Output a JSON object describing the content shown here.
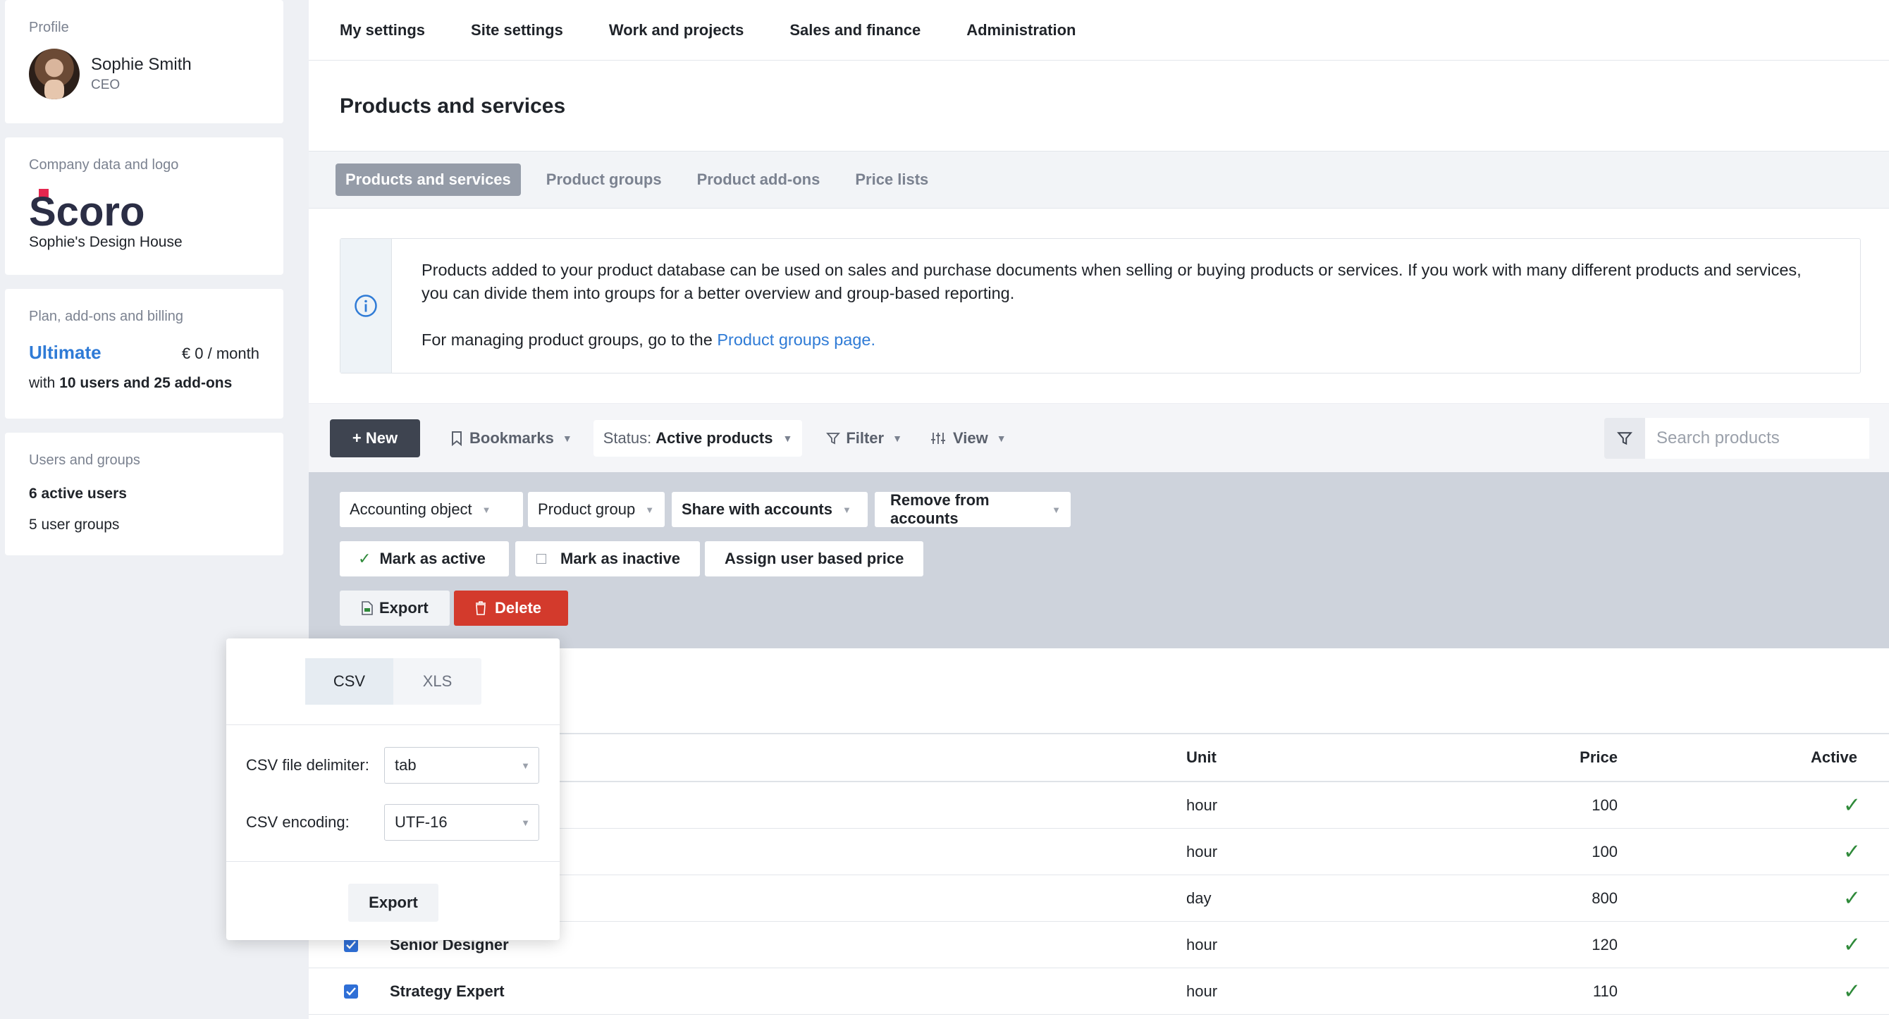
{
  "sidebar": {
    "profile": {
      "label": "Profile",
      "name": "Sophie Smith",
      "role": "CEO"
    },
    "company": {
      "label": "Company data and logo",
      "logo_text": "Scoro",
      "name": "Sophie's Design House"
    },
    "plan": {
      "label": "Plan, add-ons and billing",
      "name": "Ultimate",
      "price": "€ 0 / month",
      "detail_prefix": "with ",
      "detail_bold": "10 users and 25 add-ons"
    },
    "users": {
      "label": "Users and groups",
      "active": "6 active users",
      "groups": "5 user groups"
    }
  },
  "topnav": [
    "My settings",
    "Site settings",
    "Work and projects",
    "Sales and finance",
    "Administration"
  ],
  "page_title": "Products and services",
  "tabs": [
    {
      "label": "Products and services",
      "active": true
    },
    {
      "label": "Product groups",
      "active": false
    },
    {
      "label": "Product add-ons",
      "active": false
    },
    {
      "label": "Price lists",
      "active": false
    }
  ],
  "info": {
    "line1": "Products added to your product database can be used on sales and purchase documents when selling or buying products or services. If you work with many different products and services, you can divide them into groups for a better overview and group-based reporting.",
    "line2_prefix": "For managing product groups, go to the ",
    "link": "Product groups page."
  },
  "toolbar": {
    "new_label": "+ New",
    "bookmarks": "Bookmarks",
    "status_prefix": "Status:",
    "status_value": "Active products",
    "filter": "Filter",
    "view": "View",
    "search_placeholder": "Search products"
  },
  "bulk": {
    "accounting_object": "Accounting object",
    "product_group": "Product group",
    "share": "Share with accounts",
    "remove": "Remove from accounts",
    "mark_active": "Mark as active",
    "mark_inactive": "Mark as inactive",
    "assign_price": "Assign user based price",
    "export": "Export",
    "delete": "Delete"
  },
  "table": {
    "headers": {
      "unit": "Unit",
      "price": "Price",
      "active": "Active"
    },
    "rows": [
      {
        "name": "",
        "unit": "hour",
        "price": "100"
      },
      {
        "name": "",
        "unit": "hour",
        "price": "100"
      },
      {
        "name": "",
        "unit": "day",
        "price": "800"
      },
      {
        "name": "Senior Designer",
        "unit": "hour",
        "price": "120"
      },
      {
        "name": "Strategy Expert",
        "unit": "hour",
        "price": "110"
      }
    ]
  },
  "export_popup": {
    "formats": [
      "CSV",
      "XLS"
    ],
    "selected_format": "CSV",
    "delimiter_label": "CSV file delimiter:",
    "delimiter_value": "tab",
    "encoding_label": "CSV encoding:",
    "encoding_value": "UTF-16",
    "export_button": "Export"
  },
  "colors": {
    "accent": "#2f7bd6",
    "delete": "#d33a2c",
    "new_button": "#3e4450",
    "active_check": "#2f8a3a"
  }
}
